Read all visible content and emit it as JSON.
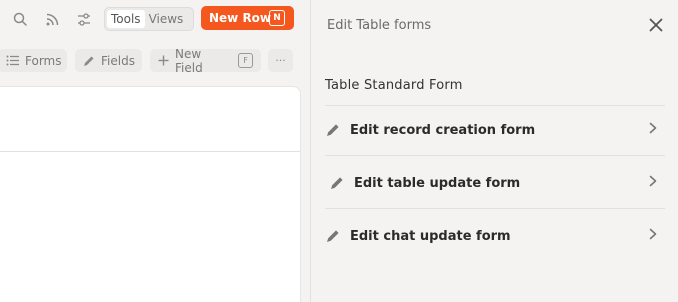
{
  "toolbar": {
    "tools_label": "Tools",
    "views_label": "Views",
    "new_row_label": "New Row",
    "new_row_shortcut": "N",
    "forms_label": "Forms",
    "fields_label": "Fields",
    "new_field_label": "New Field",
    "new_field_shortcut": "F",
    "more_label": "···"
  },
  "panel": {
    "title": "Edit Table forms",
    "section_title": "Table Standard Form",
    "items": [
      {
        "label": "Edit record creation form"
      },
      {
        "label": "Edit table update form"
      },
      {
        "label": "Edit chat update form"
      }
    ]
  },
  "colors": {
    "accent": "#f4581e",
    "background": "#f4f3f1",
    "card": "#ffffff"
  }
}
